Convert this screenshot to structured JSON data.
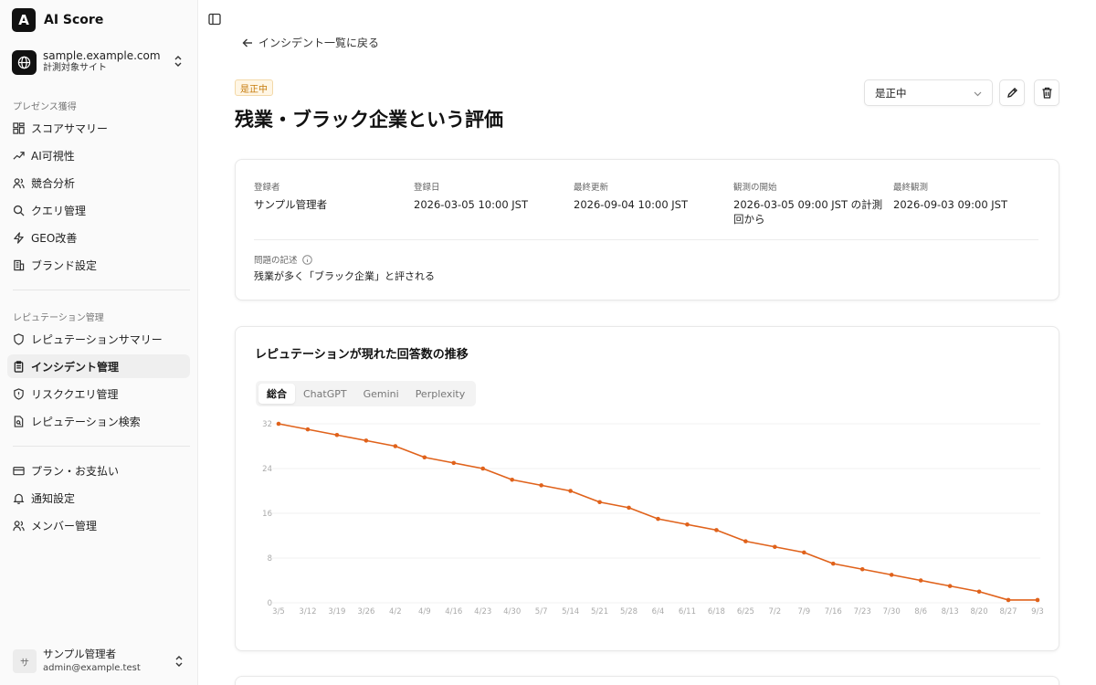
{
  "brand": {
    "logo_letter": "A",
    "name": "AI Score"
  },
  "site": {
    "domain": "sample.example.com",
    "subtitle": "計測対象サイト"
  },
  "nav": {
    "section1_heading": "プレゼンス獲得",
    "section1": [
      {
        "label": "スコアサマリー",
        "icon": "grid-icon"
      },
      {
        "label": "AI可視性",
        "icon": "trend-icon"
      },
      {
        "label": "競合分析",
        "icon": "users-icon"
      },
      {
        "label": "クエリ管理",
        "icon": "search-icon"
      },
      {
        "label": "GEO改善",
        "icon": "bolt-icon"
      },
      {
        "label": "ブランド設定",
        "icon": "building-icon"
      }
    ],
    "section2_heading": "レピュテーション管理",
    "section2": [
      {
        "label": "レピュテーションサマリー",
        "icon": "shield-icon"
      },
      {
        "label": "インシデント管理",
        "icon": "clipboard-icon",
        "active": true
      },
      {
        "label": "リスククエリ管理",
        "icon": "shield-alert-icon"
      },
      {
        "label": "レピュテーション検索",
        "icon": "file-search-icon"
      }
    ],
    "section3": [
      {
        "label": "プラン・お支払い",
        "icon": "card-icon"
      },
      {
        "label": "通知設定",
        "icon": "bell-icon"
      },
      {
        "label": "メンバー管理",
        "icon": "users-icon"
      }
    ]
  },
  "user": {
    "avatar": "サ",
    "name": "サンプル管理者",
    "email": "admin@example.test"
  },
  "header": {
    "back_label": "インシデント一覧に戻る",
    "status_badge": "是正中",
    "title": "残業・ブラック企業という評価",
    "status_select": "是正中"
  },
  "meta": {
    "registrant_label": "登録者",
    "registrant": "サンプル管理者",
    "registered_label": "登録日",
    "registered": "2026-03-05 10:00 JST",
    "updated_label": "最終更新",
    "updated": "2026-09-04 10:00 JST",
    "observe_start_label": "観測の開始",
    "observe_start": "2026-03-05 09:00 JST の計測回から",
    "last_observed_label": "最終観測",
    "last_observed": "2026-09-03 09:00 JST",
    "problem_label": "問題の記述",
    "problem": "残業が多く「ブラック企業」と評される"
  },
  "chart_section": {
    "title": "レピュテーションが現れた回答数の推移",
    "tabs": [
      "総合",
      "ChatGPT",
      "Gemini",
      "Perplexity"
    ],
    "active_tab": "総合"
  },
  "colors": {
    "line": "#e0621b",
    "accent_badge": "#c57a0a"
  },
  "chart_data": {
    "type": "line",
    "categories": [
      "3/5",
      "3/12",
      "3/19",
      "3/26",
      "4/2",
      "4/9",
      "4/16",
      "4/23",
      "4/30",
      "5/7",
      "5/14",
      "5/21",
      "5/28",
      "6/4",
      "6/11",
      "6/18",
      "6/25",
      "7/2",
      "7/9",
      "7/16",
      "7/23",
      "7/30",
      "8/6",
      "8/13",
      "8/20",
      "8/27",
      "9/3"
    ],
    "values": [
      32,
      31,
      30,
      29,
      28,
      26,
      25,
      24,
      22,
      21,
      20,
      18,
      17,
      15,
      14,
      13,
      11,
      10,
      9,
      7,
      6,
      5,
      4,
      3,
      2,
      0.5,
      0.5
    ],
    "yticks": [
      0,
      8,
      16,
      24,
      32
    ],
    "ylim": [
      0,
      32
    ],
    "grid": true
  }
}
